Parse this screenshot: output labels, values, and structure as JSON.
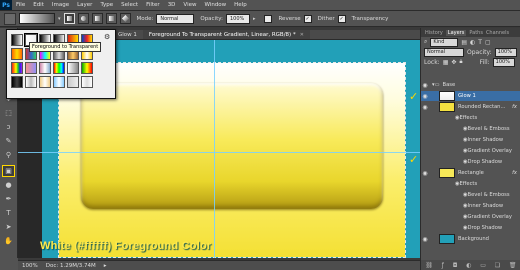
{
  "app": {
    "logo": "Ps"
  },
  "menu": [
    "File",
    "Edit",
    "Image",
    "Layer",
    "Type",
    "Select",
    "Filter",
    "3D",
    "View",
    "Window",
    "Help"
  ],
  "options_bar": {
    "mode_label": "Mode:",
    "mode_value": "Normal",
    "opacity_label": "Opacity:",
    "opacity_value": "100%",
    "reverse_label": "Reverse",
    "dither_label": "Dither",
    "transparency_label": "Transparency"
  },
  "doc_tabs": [
    {
      "label": "Glow 1",
      "active": false
    },
    {
      "label": "Foreground To Transparent Gradient, Linear, RGB/8) *",
      "active": true
    }
  ],
  "gradient_picker": {
    "tooltip": "Foreground to Transparent",
    "swatches": [
      "linear-gradient(to right,#000,#fff)",
      "linear-gradient(to right,#fff,rgba(255,255,255,0))",
      "linear-gradient(to right,#000,#fff)",
      "linear-gradient(to right,#000,rgba(0,0,0,0))",
      "linear-gradient(to right,#d21,#fd0)",
      "linear-gradient(to right,#04c,#e22,#fd0)",
      "linear-gradient(to right,#f60,#fd0,#f60)",
      "linear-gradient(to right,#c33,#36c,#3c6)",
      "linear-gradient(to right,#f0f,#0ff,#ff0)",
      "linear-gradient(to right,#666,#ddd,#666)",
      "linear-gradient(to right,#963,#fc6,#963)",
      "linear-gradient(to right,#fc0,#fff,#fc0)",
      "linear-gradient(to right,#e22,#f80,#ff0,#2c2,#22e,#a2e)",
      "linear-gradient(to right,rgba(255,0,0,.4),rgba(0,0,255,.4))",
      "linear-gradient(to right,#c8a,#fff,#8ac)",
      "linear-gradient(to right,#f00,#ff0,#0f0,#0ff,#00f)",
      "linear-gradient(to right,#fff,#888)",
      "linear-gradient(to right,#0a0,#ff0,#f00)",
      "linear-gradient(to right,#000,#444,#000)",
      "linear-gradient(to right,#fff,#bbb,#fff)",
      "linear-gradient(to right,#ec8,#fff,#ec8)",
      "linear-gradient(to right,#8cf,#fff,#8cf)",
      "linear-gradient(to right,#ccc,#eee)",
      "linear-gradient(to right,#fff,#ddd,#fff)"
    ],
    "selected_index": 1
  },
  "canvas": {
    "caption": "White (#ffffff) Foreground Color",
    "background_color": "#22a0b8"
  },
  "status": {
    "zoom": "100%",
    "doc": "Doc: 1.29M/3.74M"
  },
  "panel": {
    "tabs": [
      "History",
      "Layers",
      "Paths",
      "Channels"
    ],
    "active_tab": "Layers",
    "kind_label": "Kind",
    "blend_value": "Normal",
    "opacity_label": "Opacity:",
    "opacity_value": "100%",
    "lock_label": "Lock:",
    "fill_label": "Fill:",
    "fill_value": "100%",
    "layers": [
      {
        "name": "Base",
        "type": "group",
        "thumb": "#888"
      },
      {
        "name": "Glow 1",
        "type": "layer",
        "thumb": "linear-gradient(#fff,#eee)",
        "selected": true
      },
      {
        "name": "Rounded Rectan...",
        "type": "layer",
        "thumb": "#f3e040",
        "fx": true
      },
      {
        "name": "Effects",
        "type": "fx-head"
      },
      {
        "name": "Bevel & Emboss",
        "type": "fx"
      },
      {
        "name": "Inner Shadow",
        "type": "fx"
      },
      {
        "name": "Gradient Overlay",
        "type": "fx"
      },
      {
        "name": "Drop Shadow",
        "type": "fx"
      },
      {
        "name": "Rectangle",
        "type": "layer",
        "thumb": "#f6e858",
        "fx": true
      },
      {
        "name": "Effects",
        "type": "fx-head"
      },
      {
        "name": "Bevel & Emboss",
        "type": "fx"
      },
      {
        "name": "Inner Shadow",
        "type": "fx"
      },
      {
        "name": "Gradient Overlay",
        "type": "fx"
      },
      {
        "name": "Drop Shadow",
        "type": "fx"
      },
      {
        "name": "Background",
        "type": "layer",
        "thumb": "#22a0b8"
      }
    ],
    "bottom_icons": [
      "link-icon",
      "fx-icon",
      "mask-icon",
      "adjustment-icon",
      "folder-icon",
      "new-layer-icon",
      "trash-icon"
    ]
  }
}
